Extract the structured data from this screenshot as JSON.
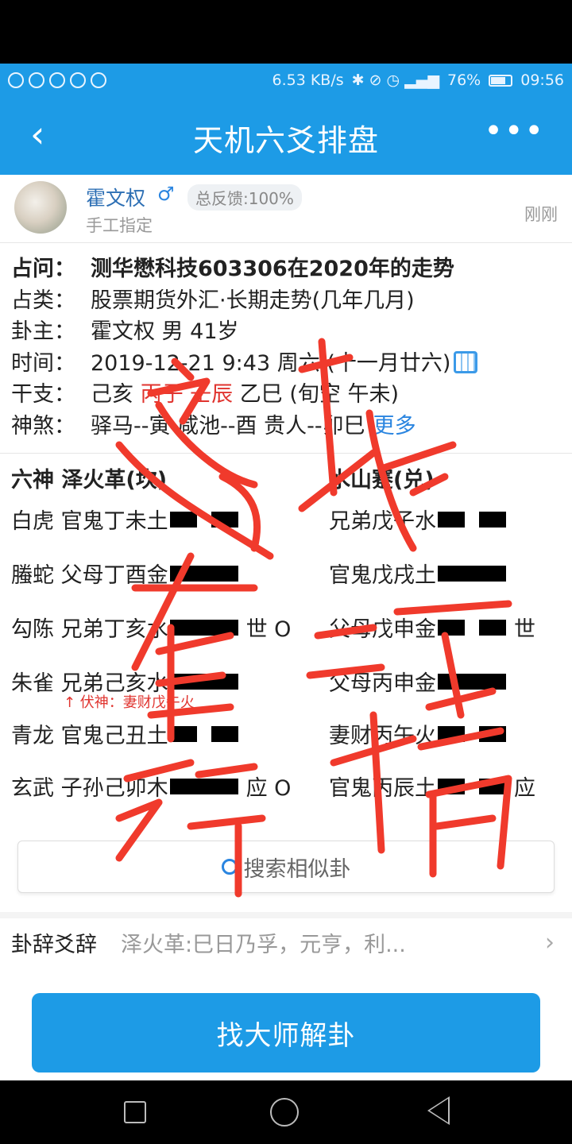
{
  "status_bar": {
    "network_speed": "6.53 KB/s",
    "battery": "76%",
    "battery_level": 0.76,
    "time": "09:56"
  },
  "nav": {
    "title": "天机六爻排盘"
  },
  "user": {
    "name": "霍文权",
    "gender_symbol": "♂",
    "feedback": "总反馈:100%",
    "subtitle": "手工指定",
    "time_ago": "刚刚"
  },
  "info": {
    "question_label": "占问：",
    "question": "测华懋科技603306在2020年的走势",
    "category_label": "占类：",
    "category": "股票期货外汇·长期走势(几年几月)",
    "owner_label": "卦主：",
    "owner": "霍文权 男 41岁",
    "time_label": "时间：",
    "time": "2019-12-21 9:43 周六 (十一月廿六)",
    "ganzhi_label": "干支：",
    "ganzhi_a": "己亥",
    "ganzhi_b": "丙子 壬辰",
    "ganzhi_c": "乙巳 (旬空 午未)",
    "shensha_label": "神煞：",
    "shensha": "驿马--寅  咸池--酉  贵人--卯巳",
    "more": "更多"
  },
  "gua": {
    "header_left": "六神  泽火革(坎)",
    "header_right": "水山蹇(兑)",
    "lines_left": [
      {
        "text": "白虎 官鬼丁未土",
        "yao": "yin",
        "mark": ""
      },
      {
        "text": "螣蛇 父母丁酉金",
        "yao": "yang",
        "mark": ""
      },
      {
        "text": "勾陈 兄弟丁亥水",
        "yao": "yang",
        "mark": "世 O"
      },
      {
        "text": "朱雀 兄弟己亥水",
        "yao": "yang",
        "mark": ""
      },
      {
        "text": "青龙 官鬼己丑土",
        "yao": "yin",
        "mark": ""
      },
      {
        "text": "玄武 子孙己卯木",
        "yao": "yang",
        "mark": "应 O"
      }
    ],
    "lines_right": [
      {
        "text": "兄弟戊子水",
        "yao": "yin",
        "mark": ""
      },
      {
        "text": "官鬼戊戌土",
        "yao": "yang",
        "mark": ""
      },
      {
        "text": "父母戊申金",
        "yao": "yin",
        "mark": "世"
      },
      {
        "text": "父母丙申金",
        "yao": "yang",
        "mark": ""
      },
      {
        "text": "妻财丙午火",
        "yao": "yin",
        "mark": ""
      },
      {
        "text": "官鬼丙辰土",
        "yao": "yin",
        "mark": "应"
      }
    ],
    "fushen": "↑ 伏神：妻财戊午火"
  },
  "search_button": "搜索相似卦",
  "guaci": {
    "label": "卦辞爻辞",
    "preview": "泽火革:巳日乃孚，元亨，利..."
  },
  "main_button": "找大师解卦",
  "colors": {
    "brand_blue": "#1d9be6",
    "accent_red": "#e0342f",
    "link_blue": "#2a85e0"
  }
}
